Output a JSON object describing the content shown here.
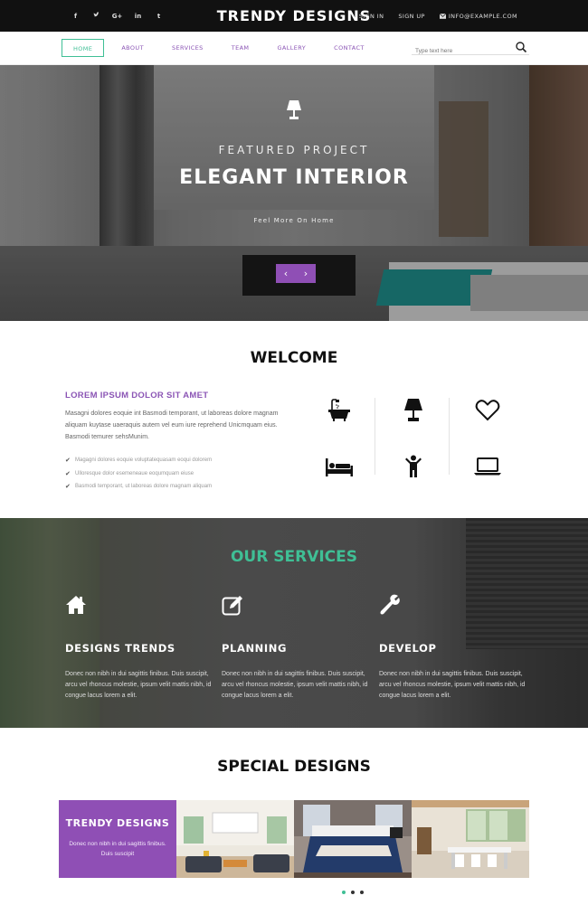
{
  "topbar": {
    "social": [
      {
        "icon": "facebook-icon",
        "glyph": "f"
      },
      {
        "icon": "twitter-icon",
        "glyph": "t"
      },
      {
        "icon": "google-plus-icon",
        "glyph": "G+"
      },
      {
        "icon": "linkedin-icon",
        "glyph": "in"
      },
      {
        "icon": "tumblr-icon",
        "glyph": "t"
      }
    ],
    "brand": "TRENDY DESIGNS",
    "sign_in": "SIGN IN",
    "sign_up": "SIGN UP",
    "email": "INFO@EXAMPLE.COM"
  },
  "nav": {
    "items": [
      {
        "label": "HOME",
        "active": true
      },
      {
        "label": "ABOUT"
      },
      {
        "label": "SERVICES"
      },
      {
        "label": "TEAM"
      },
      {
        "label": "GALLERY"
      },
      {
        "label": "CONTACT"
      }
    ],
    "search_placeholder": "Type text here"
  },
  "hero": {
    "subtitle": "FEATURED PROJECT",
    "title": "ELEGANT INTERIOR",
    "link": "Feel More On Home",
    "prev": "‹",
    "next": "›"
  },
  "welcome": {
    "title": "WELCOME",
    "subtitle": "LOREM IPSUM DOLOR SIT AMET",
    "text": "Masagni dolores eoquie int Basmodi temporant, ut laboreas dolore magnam aliquam kuytase uaeraquis autem vel eum iure reprehend Unicmquam eius. Basmodi temurer sehsMunim.",
    "checklist": [
      "Magagni dolores eoquie voluptatequasam eoqui dolorem",
      "Ulloresque dolor esemeneaue eoqumquam eiuse",
      "Basmodi temporant, ut laboreas dolore magnam aliquam"
    ],
    "icons": [
      "bathtub-icon",
      "table-lamp-icon",
      "heart-icon",
      "bed-icon",
      "child-icon",
      "laptop-icon"
    ]
  },
  "services": {
    "title": "OUR SERVICES",
    "items": [
      {
        "icon": "home-icon",
        "name": "DESIGNS TRENDS",
        "text": "Donec non nibh in dui sagittis finibus. Duis suscipit, arcu vel rhoncus molestie, ipsum velit mattis nibh, id congue lacus lorem a elit."
      },
      {
        "icon": "edit-icon",
        "name": "PLANNING",
        "text": "Donec non nibh in dui sagittis finibus. Duis suscipit, arcu vel rhoncus molestie, ipsum velit mattis nibh, id congue lacus lorem a elit."
      },
      {
        "icon": "wrench-icon",
        "name": "DEVELOP",
        "text": "Donec non nibh in dui sagittis finibus. Duis suscipit, arcu vel rhoncus molestie, ipsum velit mattis nibh, id congue lacus lorem a elit."
      }
    ]
  },
  "special": {
    "title": "SPECIAL DESIGNS",
    "promo_title": "TRENDY DESIGNS",
    "promo_text": "Donec non nibh in dui sagittis finibus. Duis suscipit",
    "carousel_dots": 3,
    "active_dot": 1
  },
  "colors": {
    "accent_purple": "#8f4fb5",
    "accent_green": "#3fbf95",
    "topbar": "#111111"
  }
}
